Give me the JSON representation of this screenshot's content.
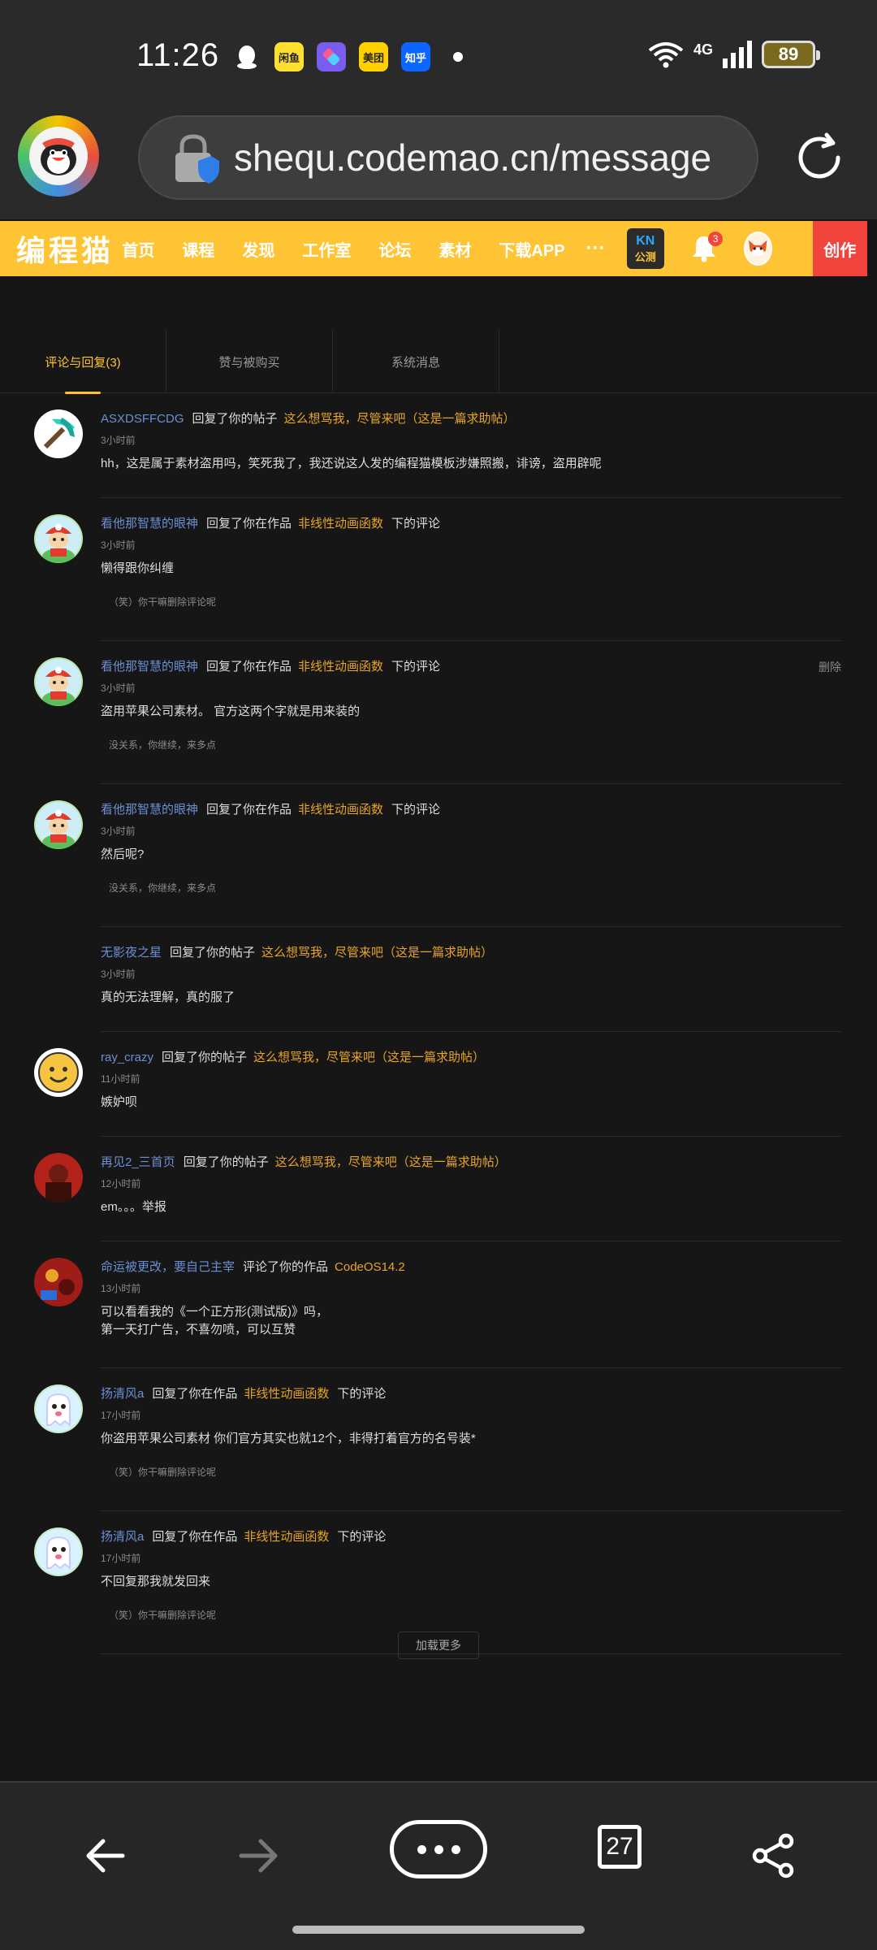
{
  "status_bar": {
    "time": "11:26",
    "apps": [
      {
        "name": "qq-icon",
        "label": "",
        "bg": "#1db0f5",
        "color": "#fff"
      },
      {
        "name": "xianyu-icon",
        "label": "闲鱼",
        "bg": "#ffe02f",
        "color": "#222"
      },
      {
        "name": "shortcuts-icon",
        "label": "",
        "bg": "#7b5cf0",
        "color": "#fff"
      },
      {
        "name": "meituan-icon",
        "label": "美团",
        "bg": "#ffd100",
        "color": "#222"
      },
      {
        "name": "zhihu-icon",
        "label": "知乎",
        "bg": "#0a66ff",
        "color": "#fff"
      }
    ],
    "network": "4G",
    "battery": "89"
  },
  "browser": {
    "url": "shequ.codemao.cn/message"
  },
  "codemao_header": {
    "logo": "编程猫",
    "nav": [
      "首页",
      "课程",
      "发现",
      "工作室",
      "论坛",
      "素材",
      "下载APP"
    ],
    "more": "···",
    "kn_top": "KN",
    "kn_bottom": "公测",
    "bell_count": "3",
    "create": "创作",
    "brand_color": "#fec433",
    "create_color": "#f0443d"
  },
  "tabs": [
    {
      "label": "评论与回复(3)",
      "active": true
    },
    {
      "label": "赞与被购买",
      "active": false
    },
    {
      "label": "系统消息",
      "active": false
    }
  ],
  "messages": [
    {
      "user": "ASXDSFFCDG",
      "action": "回复了你的帖子",
      "target": "这么想骂我，尽管来吧（这是一篇求助帖）",
      "suffix": "",
      "time": "3小时前",
      "text": "hh，这是属于素材盗用吗，笑死我了，我还说这人发的编程猫模板涉嫌照搬，诽谤，盗用辟呢",
      "quote": "",
      "delete": "",
      "avatar": "pickaxe"
    },
    {
      "user": "看他那智慧的眼神",
      "action": "回复了你在作品",
      "target": "非线性动画函数",
      "suffix": "下的评论",
      "time": "3小时前",
      "text": "懒得跟你纠缠",
      "quote": "（笑）你干嘛删除评论呢",
      "delete": "",
      "avatar": "mario"
    },
    {
      "user": "看他那智慧的眼神",
      "action": "回复了你在作品",
      "target": "非线性动画函数",
      "suffix": "下的评论",
      "time": "3小时前",
      "text": "盗用苹果公司素材。 官方这两个字就是用来装的",
      "quote": "没关系，你继续，来多点",
      "delete": "删除",
      "avatar": "mario"
    },
    {
      "user": "看他那智慧的眼神",
      "action": "回复了你在作品",
      "target": "非线性动画函数",
      "suffix": "下的评论",
      "time": "3小时前",
      "text": "然后呢?",
      "quote": "没关系，你继续，来多点",
      "delete": "",
      "avatar": "mario"
    },
    {
      "user": "无影夜之星",
      "action": "回复了你的帖子",
      "target": "这么想骂我，尽管来吧（这是一篇求助帖）",
      "suffix": "",
      "time": "3小时前",
      "text": "真的无法理解，真的服了",
      "quote": "",
      "delete": "",
      "avatar": "none"
    },
    {
      "user": "ray_crazy",
      "action": "回复了你的帖子",
      "target": "这么想骂我，尽管来吧（这是一篇求助帖）",
      "suffix": "",
      "time": "11小时前",
      "text": "嫉妒呗",
      "quote": "",
      "delete": "",
      "avatar": "smiley"
    },
    {
      "user": "再见2_三首页",
      "action": "回复了你的帖子",
      "target": "这么想骂我，尽管来吧（这是一篇求助帖）",
      "suffix": "",
      "time": "12小时前",
      "text": "em。。。举报",
      "quote": "",
      "delete": "",
      "avatar": "red"
    },
    {
      "user": "命运被更改，要自己主宰",
      "action": "评论了你的作品",
      "target": "CodeOS14.2",
      "suffix": "",
      "time": "13小时前",
      "text": "可以看看我的《一个正方形(测试版)》吗，\n第一天打广告，不喜勿喷，可以互赞",
      "quote": "",
      "delete": "",
      "avatar": "red2"
    },
    {
      "user": "扬清风a",
      "action": "回复了你在作品",
      "target": "非线性动画函数",
      "suffix": "下的评论",
      "time": "17小时前",
      "text": "你盗用苹果公司素材 你们官方其实也就12个，非得打着官方的名号装*",
      "quote": "（笑）你干嘛删除评论呢",
      "delete": "",
      "avatar": "ghost"
    },
    {
      "user": "扬清风a",
      "action": "回复了你在作品",
      "target": "非线性动画函数",
      "suffix": "下的评论",
      "time": "17小时前",
      "text": "不回复那我就发回来",
      "quote": "（笑）你干嘛删除评论呢",
      "delete": "",
      "avatar": "ghost"
    }
  ],
  "load_more": "加载更多",
  "bottom_bar": {
    "tab_count": "27"
  }
}
